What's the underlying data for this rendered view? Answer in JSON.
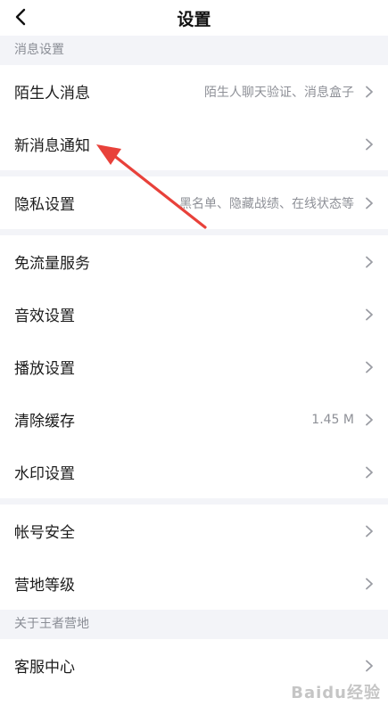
{
  "header": {
    "title": "设置",
    "back_icon": "chevron-left-icon"
  },
  "sections": {
    "message": {
      "label": "消息设置"
    },
    "about": {
      "label": "关于王者营地"
    }
  },
  "rows": {
    "stranger": {
      "label": "陌生人消息",
      "value": "陌生人聊天验证、消息盒子"
    },
    "notify": {
      "label": "新消息通知"
    },
    "privacy": {
      "label": "隐私设置",
      "value": "黑名单、隐藏战绩、在线状态等"
    },
    "dataFree": {
      "label": "免流量服务"
    },
    "sound": {
      "label": "音效设置"
    },
    "playback": {
      "label": "播放设置"
    },
    "cache": {
      "label": "清除缓存",
      "value": "1.45 M"
    },
    "watermark": {
      "label": "水印设置"
    },
    "account": {
      "label": "帐号安全"
    },
    "level": {
      "label": "营地等级"
    },
    "service": {
      "label": "客服中心"
    }
  },
  "overlay": {
    "watermark_text": "Baidu经验",
    "arrow_color": "#e8413a"
  },
  "colors": {
    "background": "#f3f4f8",
    "row": "#ffffff",
    "muted": "#8e9097"
  }
}
